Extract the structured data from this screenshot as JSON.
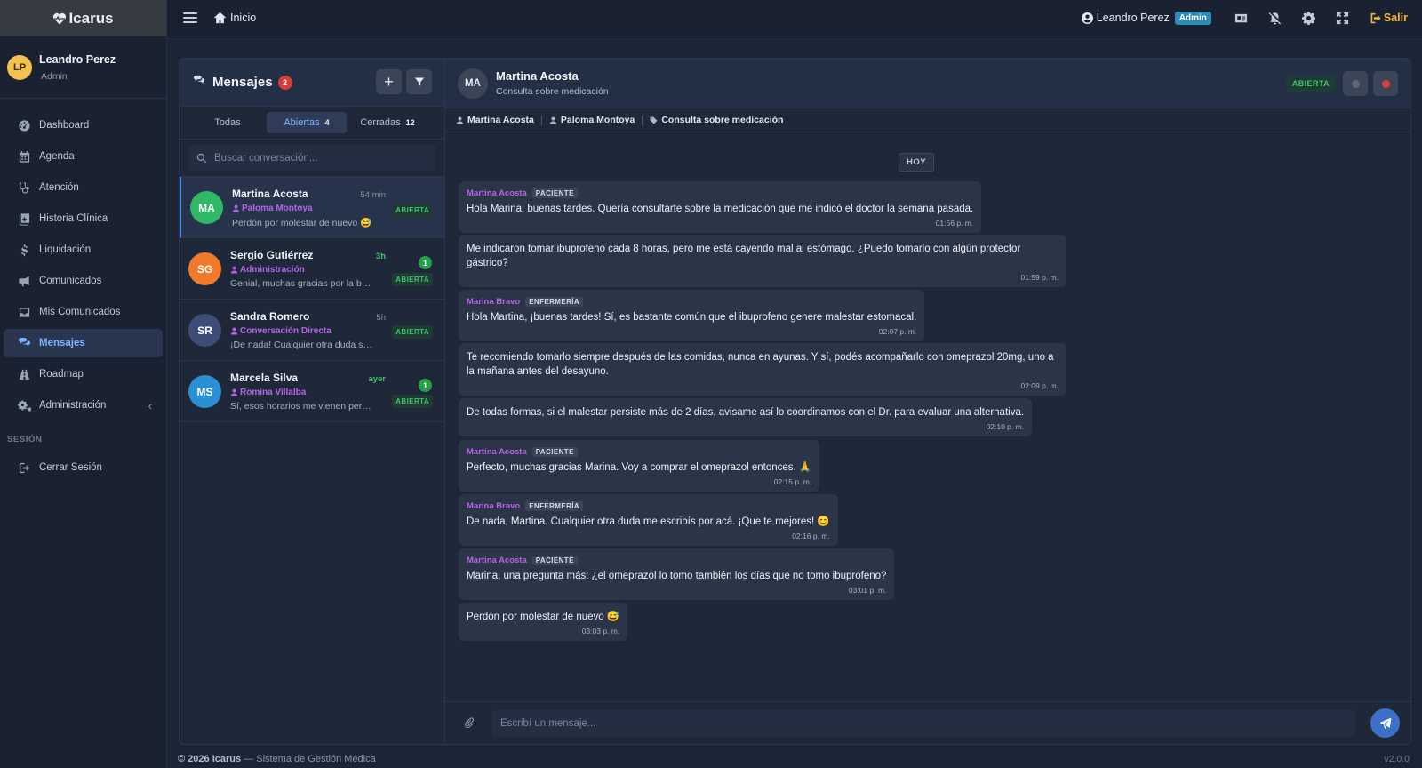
{
  "app": {
    "name": "Icarus"
  },
  "user": {
    "initials": "LP",
    "name": "Leandro Perez",
    "role": "Admin",
    "badge": "Admin"
  },
  "sidebar": {
    "items": [
      {
        "label": "Dashboard",
        "icon": "dashboard-icon"
      },
      {
        "label": "Agenda",
        "icon": "calendar-icon"
      },
      {
        "label": "Atención",
        "icon": "stethoscope-icon"
      },
      {
        "label": "Historia Clínica",
        "icon": "medical-record-icon"
      },
      {
        "label": "Liquidación",
        "icon": "dollar-icon"
      },
      {
        "label": "Comunicados",
        "icon": "megaphone-icon"
      },
      {
        "label": "Mis Comunicados",
        "icon": "inbox-icon"
      },
      {
        "label": "Mensajes",
        "icon": "chat-icon",
        "active": true
      },
      {
        "label": "Roadmap",
        "icon": "road-icon"
      },
      {
        "label": "Administración",
        "icon": "cogs-icon"
      }
    ],
    "section_label": "SESIÓN",
    "logout_label": "Cerrar Sesión"
  },
  "topbar": {
    "home_label": "Inicio",
    "logout_label": "Salir"
  },
  "messages_panel": {
    "title": "Mensajes",
    "count": "2",
    "tabs": [
      {
        "label": "Todas",
        "count": ""
      },
      {
        "label": "Abiertas",
        "count": "4"
      },
      {
        "label": "Cerradas",
        "count": "12"
      }
    ],
    "search_placeholder": "Buscar conversación...",
    "conversations": [
      {
        "initials": "MA",
        "name": "Martina Acosta",
        "assignee": "Paloma Montoya",
        "last": "Perdón por molestar de nuevo 😅",
        "time": "54 min",
        "unread": "",
        "status": "ABIERTA",
        "color": "#2fb866"
      },
      {
        "initials": "SG",
        "name": "Sergio Gutiérrez",
        "assignee": "Administración",
        "last": "Genial, muchas gracias por la bue...",
        "time": "3h",
        "unread": "1",
        "status": "ABIERTA",
        "color": "#f07a2a"
      },
      {
        "initials": "SR",
        "name": "Sandra Romero",
        "assignee": "Conversación Directa",
        "last": "¡De nada! Cualquier otra duda sob...",
        "time": "5h",
        "unread": "",
        "status": "ABIERTA",
        "color": "#3d4d78"
      },
      {
        "initials": "MS",
        "name": "Marcela Silva",
        "assignee": "Romina Villalba",
        "last": "Sí, esos horarios me vienen perfe...",
        "time": "ayer",
        "unread": "1",
        "status": "ABIERTA",
        "color": "#2a8fd4"
      }
    ]
  },
  "chat": {
    "initials": "MA",
    "name": "Martina Acosta",
    "subject": "Consulta sobre medicación",
    "status": "ABIERTA",
    "crumbs": {
      "patient": "Martina Acosta",
      "professional": "Paloma Montoya",
      "topic": "Consulta sobre medicación"
    },
    "day_label": "HOY",
    "messages": [
      {
        "author": "Martina Acosta",
        "role": "PACIENTE",
        "text": "Hola Marina, buenas tardes. Quería consultarte sobre la medicación que me indicó el doctor la semana pasada.",
        "time": "01:56 p. m."
      },
      {
        "author": "",
        "role": "",
        "text": "Me indicaron tomar ibuprofeno cada 8 horas, pero me está cayendo mal al estómago. ¿Puedo tomarlo con algún protector gástrico?",
        "time": "01:59 p. m."
      },
      {
        "author": "Marina Bravo",
        "role": "ENFERMERÍA",
        "text": "Hola Martina, ¡buenas tardes! Sí, es bastante común que el ibuprofeno genere malestar estomacal.",
        "time": "02:07 p. m."
      },
      {
        "author": "",
        "role": "",
        "text": "Te recomiendo tomarlo siempre después de las comidas, nunca en ayunas. Y sí, podés acompañarlo con omeprazol 20mg, uno a la mañana antes del desayuno.",
        "time": "02:09 p. m."
      },
      {
        "author": "",
        "role": "",
        "text": "De todas formas, si el malestar persiste más de 2 días, avisame así lo coordinamos con el Dr. para evaluar una alternativa.",
        "time": "02:10 p. m."
      },
      {
        "author": "Martina Acosta",
        "role": "PACIENTE",
        "text": "Perfecto, muchas gracias Marina. Voy a comprar el omeprazol entonces. 🙏",
        "time": "02:15 p. m."
      },
      {
        "author": "Marina Bravo",
        "role": "ENFERMERÍA",
        "text": "De nada, Martina. Cualquier otra duda me escribís por acá. ¡Que te mejores! 😊",
        "time": "02:16 p. m."
      },
      {
        "author": "Martina Acosta",
        "role": "PACIENTE",
        "text": "Marina, una pregunta más: ¿el omeprazol lo tomo también los días que no tomo ibuprofeno?",
        "time": "03:01 p. m."
      },
      {
        "author": "",
        "role": "",
        "text": "Perdón por molestar de nuevo 😅",
        "time": "03:03 p. m."
      }
    ],
    "composer_placeholder": "Escribí un mensaje..."
  },
  "footer": {
    "brand": "© 2026 Icarus",
    "suffix": "— Sistema de Gestión Médica",
    "version": "v2.0.0"
  },
  "colors": {
    "accent": "#4f8cf0",
    "open_status": "#3ec46d",
    "author": "#b564e8",
    "warning": "#f2b43c"
  }
}
